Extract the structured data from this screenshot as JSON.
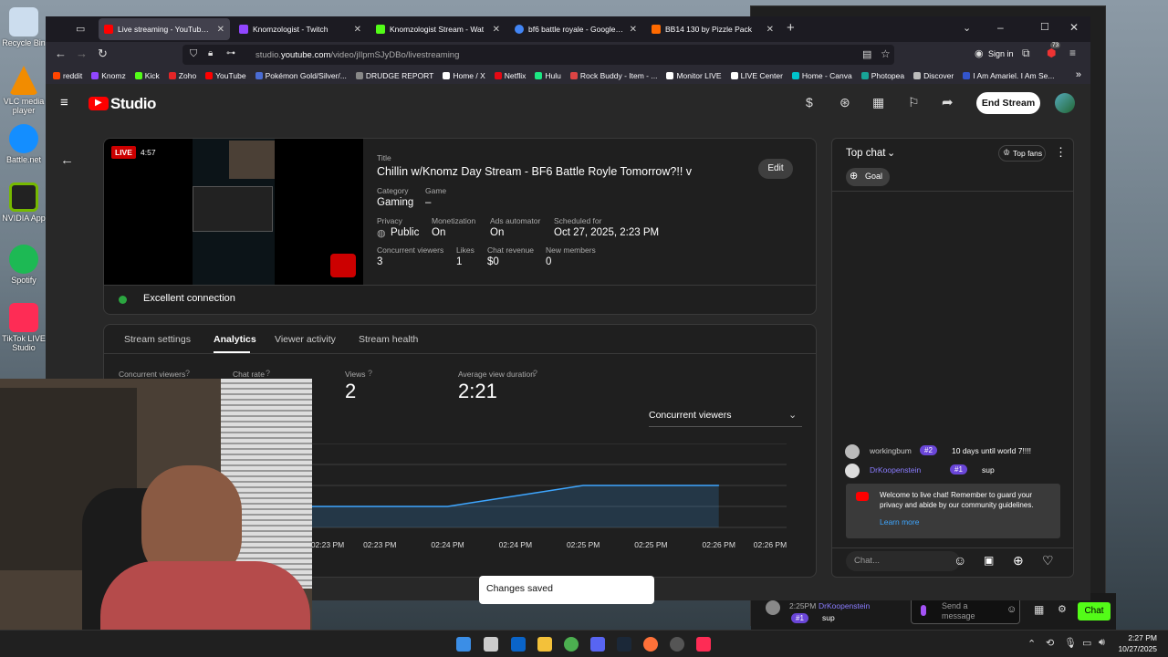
{
  "desktop": {
    "icons": [
      {
        "label": "Recycle Bin",
        "color": "#bcd"
      },
      {
        "label": "VLC media player",
        "color": "#f28c00"
      },
      {
        "label": "Battle.net",
        "color": "#148eff"
      },
      {
        "label": "NVIDIA App",
        "color": "#76b900"
      },
      {
        "label": "Spotify",
        "color": "#1db954"
      },
      {
        "label": "TikTok LIVE Studio",
        "color": "#fe2c55"
      }
    ]
  },
  "browser": {
    "tabs": [
      {
        "label": "Live streaming - YouTube Studio",
        "color": "#ff0000"
      },
      {
        "label": "Knomzologist - Twitch",
        "color": "#9146ff"
      },
      {
        "label": "Knomzologist Stream - Wat",
        "color": "#53fc18"
      },
      {
        "label": "bf6 battle royale - Google Search",
        "color": "#4285f4"
      },
      {
        "label": "BB14 130 by Pizzle Pack",
        "color": "#ff6a00"
      }
    ],
    "url_prefix": "studio.",
    "url_domain": "youtube.com",
    "url_path": "/video/jIlpmSJyDBo/livestreaming",
    "sign_in": "Sign in",
    "badge_count": "73",
    "bookmarks": [
      {
        "label": "reddit",
        "color": "#ff4500"
      },
      {
        "label": "Knomz",
        "color": "#9146ff"
      },
      {
        "label": "Kick",
        "color": "#53fc18"
      },
      {
        "label": "Zoho",
        "color": "#e42527"
      },
      {
        "label": "YouTube",
        "color": "#ff0000"
      },
      {
        "label": "Pokémon Gold/Silver/...",
        "color": "#4a6cd4"
      },
      {
        "label": "DRUDGE REPORT",
        "color": "#888888"
      },
      {
        "label": "Home / X",
        "color": "#ffffff"
      },
      {
        "label": "Netflix",
        "color": "#e50914"
      },
      {
        "label": "Hulu",
        "color": "#1ce783"
      },
      {
        "label": "Rock Buddy - Item - ...",
        "color": "#d44"
      },
      {
        "label": "Monitor LIVE",
        "color": "#ffffff"
      },
      {
        "label": "LIVE Center",
        "color": "#ffffff"
      },
      {
        "label": "Home - Canva",
        "color": "#00c4cc"
      },
      {
        "label": "Photopea",
        "color": "#18a497"
      },
      {
        "label": "Discover",
        "color": "#bbbbbb"
      },
      {
        "label": "I Am Amariel. I Am Se...",
        "color": "#3355cc"
      }
    ]
  },
  "studio": {
    "logo_text": "Studio",
    "end_stream": "End Stream",
    "preview": {
      "live_label": "LIVE",
      "duration": "4:57"
    },
    "edit_label": "Edit",
    "title_label": "Title",
    "title": "Chillin w/Knomz Day Stream - BF6 Battle Royle Tomorrow?!! v",
    "category_label": "Category",
    "category": "Gaming",
    "game_label": "Game",
    "game": "–",
    "privacy_label": "Privacy",
    "privacy": "Public",
    "monetization_label": "Monetization",
    "monetization": "On",
    "ads_label": "Ads automator",
    "ads": "On",
    "scheduled_label": "Scheduled for",
    "scheduled": "Oct 27, 2025, 2:23 PM",
    "concurrent_label": "Concurrent viewers",
    "concurrent": "3",
    "likes_label": "Likes",
    "likes": "1",
    "revenue_label": "Chat revenue",
    "revenue": "$0",
    "members_label": "New members",
    "members": "0",
    "connection": "Excellent connection",
    "connection_color": "#2ba640",
    "tabs": [
      "Stream settings",
      "Analytics",
      "Viewer activity",
      "Stream health"
    ],
    "stats": [
      {
        "label": "Concurrent viewers",
        "value": ""
      },
      {
        "label": "Chat rate",
        "value": ""
      },
      {
        "label": "Views",
        "value": "2"
      },
      {
        "label": "Average view duration",
        "value": "2:21"
      }
    ],
    "chart_select": "Concurrent viewers",
    "toast": "Changes saved"
  },
  "chart_data": {
    "type": "area",
    "x": [
      "02:23 PM",
      "02:23 PM",
      "02:24 PM",
      "02:24 PM",
      "02:25 PM",
      "02:25 PM",
      "02:26 PM",
      "02:26 PM"
    ],
    "values": [
      1,
      1,
      1,
      1.5,
      2,
      2,
      2,
      null
    ],
    "ylim": [
      0,
      4
    ],
    "grid": true,
    "color": "#3ea6ff"
  },
  "chat": {
    "header": "Top chat",
    "top_fans": "Top fans",
    "goal": "Goal",
    "messages": [
      {
        "user": "workingbum",
        "badge": "#2",
        "text": "10 days until world 7!!!!"
      },
      {
        "user": "DrKoopenstein",
        "badge": "#1",
        "text": "sup"
      }
    ],
    "welcome": "Welcome to live chat! Remember to guard your privacy and abide by our community guidelines.",
    "learn_more": "Learn more",
    "input_placeholder": "Chat..."
  },
  "bg_window": {
    "time": "2:25PM",
    "user": "DrKoopenstein",
    "badge": "#1",
    "text": "sup",
    "send_placeholder": "Send a message",
    "chat_button": "Chat"
  },
  "taskbar": {
    "time": "2:27 PM",
    "date": "10/27/2025"
  }
}
